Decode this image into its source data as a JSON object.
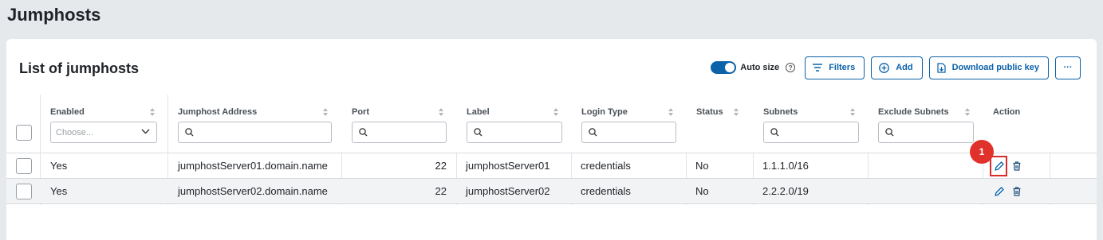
{
  "page": {
    "title": "Jumphosts"
  },
  "card": {
    "title": "List of jumphosts"
  },
  "toolbar": {
    "auto_size_label": "Auto size",
    "auto_size_on": true,
    "help_glyph": "?",
    "filters_label": "Filters",
    "add_label": "Add",
    "download_label": "Download public key",
    "more_glyph": "···"
  },
  "table": {
    "columns": [
      {
        "key": "enabled",
        "title": "Enabled",
        "filter": "select",
        "placeholder": "Choose..."
      },
      {
        "key": "address",
        "title": "Jumphost Address",
        "filter": "search"
      },
      {
        "key": "port",
        "title": "Port",
        "filter": "search"
      },
      {
        "key": "label",
        "title": "Label",
        "filter": "search"
      },
      {
        "key": "login_type",
        "title": "Login Type",
        "filter": "search"
      },
      {
        "key": "status",
        "title": "Status",
        "filter": "none"
      },
      {
        "key": "subnets",
        "title": "Subnets",
        "filter": "search"
      },
      {
        "key": "exclude_subnets",
        "title": "Exclude Subnets",
        "filter": "search"
      },
      {
        "key": "action",
        "title": "Action",
        "filter": "none"
      }
    ],
    "rows": [
      {
        "enabled": "Yes",
        "address": "jumphostServer01.domain.name",
        "port": "22",
        "label": "jumphostServer01",
        "login_type": "credentials",
        "status": "No",
        "subnets": "1.1.1.0/16",
        "exclude_subnets": ""
      },
      {
        "enabled": "Yes",
        "address": "jumphostServer02.domain.name",
        "port": "22",
        "label": "jumphostServer02",
        "login_type": "credentials",
        "status": "No",
        "subnets": "2.2.2.0/19",
        "exclude_subnets": ""
      }
    ]
  },
  "annotation": {
    "step_number": "1"
  },
  "colors": {
    "accent": "#0b62a9",
    "highlight": "#d92b2b",
    "badge": "#e0322b"
  },
  "icons": [
    "help-icon",
    "filter-icon",
    "plus-circle-icon",
    "download-icon",
    "more-icon",
    "search-icon",
    "chevron-down-icon",
    "sort-icon",
    "pencil-icon",
    "trash-icon"
  ]
}
